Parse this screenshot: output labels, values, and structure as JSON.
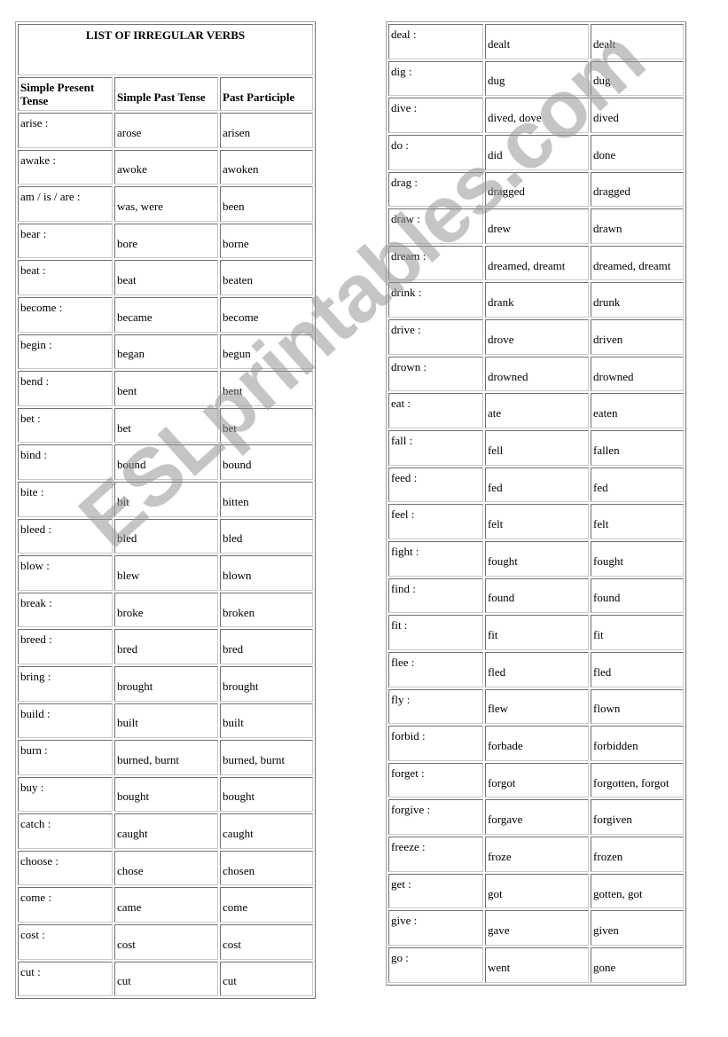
{
  "title": "LIST OF IRREGULAR VERBS",
  "headers": [
    "Simple Present Tense",
    "Simple Past Tense",
    "Past Participle"
  ],
  "watermark": "ESLprintables.com",
  "left_rows": [
    [
      "arise :",
      "arose",
      "arisen"
    ],
    [
      "awake :",
      "awoke",
      "awoken"
    ],
    [
      "am / is / are :",
      "was, were",
      "been"
    ],
    [
      "bear :",
      "bore",
      "borne"
    ],
    [
      "beat :",
      "beat",
      "beaten"
    ],
    [
      "become :",
      "became",
      "become"
    ],
    [
      "begin :",
      "began",
      "begun"
    ],
    [
      "bend :",
      "bent",
      "bent"
    ],
    [
      "bet :",
      "bet",
      "bet"
    ],
    [
      "bind :",
      "bound",
      "bound"
    ],
    [
      "bite :",
      "bit",
      "bitten"
    ],
    [
      "bleed :",
      "bled",
      "bled"
    ],
    [
      "blow :",
      "blew",
      "blown"
    ],
    [
      "break :",
      "broke",
      "broken"
    ],
    [
      "breed :",
      "bred",
      "bred"
    ],
    [
      "bring :",
      "brought",
      "brought"
    ],
    [
      "build :",
      "built",
      "built"
    ],
    [
      "burn :",
      "burned, burnt",
      "burned, burnt"
    ],
    [
      "buy :",
      "bought",
      "bought"
    ],
    [
      "catch :",
      "caught",
      "caught"
    ],
    [
      "choose :",
      "chose",
      "chosen"
    ],
    [
      "come :",
      "came",
      "come"
    ],
    [
      "cost :",
      "cost",
      "cost"
    ],
    [
      "cut :",
      "cut",
      "cut"
    ]
  ],
  "right_rows": [
    [
      "deal :",
      "dealt",
      "dealt"
    ],
    [
      "dig :",
      "dug",
      "dug"
    ],
    [
      "dive :",
      "dived, dove",
      "dived"
    ],
    [
      "do :",
      "did",
      "done"
    ],
    [
      "drag :",
      "dragged",
      "dragged"
    ],
    [
      "draw :",
      "drew",
      "drawn"
    ],
    [
      "dream :",
      "dreamed, dreamt",
      "dreamed, dreamt"
    ],
    [
      "drink :",
      "drank",
      "drunk"
    ],
    [
      "drive :",
      "drove",
      "driven"
    ],
    [
      "drown :",
      "drowned",
      "drowned"
    ],
    [
      "eat :",
      "ate",
      "eaten"
    ],
    [
      "fall :",
      "fell",
      "fallen"
    ],
    [
      "feed :",
      "fed",
      "fed"
    ],
    [
      "feel :",
      "felt",
      "felt"
    ],
    [
      "fight :",
      "fought",
      "fought"
    ],
    [
      "find :",
      "found",
      "found"
    ],
    [
      "fit :",
      "fit",
      "fit"
    ],
    [
      "flee :",
      "fled",
      "fled"
    ],
    [
      "fly :",
      "flew",
      "flown"
    ],
    [
      "forbid :",
      "forbade",
      "forbidden"
    ],
    [
      "forget :",
      "forgot",
      "forgotten, forgot"
    ],
    [
      "forgive :",
      "forgave",
      "forgiven"
    ],
    [
      "freeze :",
      "froze",
      "frozen"
    ],
    [
      "get :",
      "got",
      "gotten, got"
    ],
    [
      "give :",
      "gave",
      "given"
    ],
    [
      "go :",
      "went",
      "gone"
    ]
  ]
}
